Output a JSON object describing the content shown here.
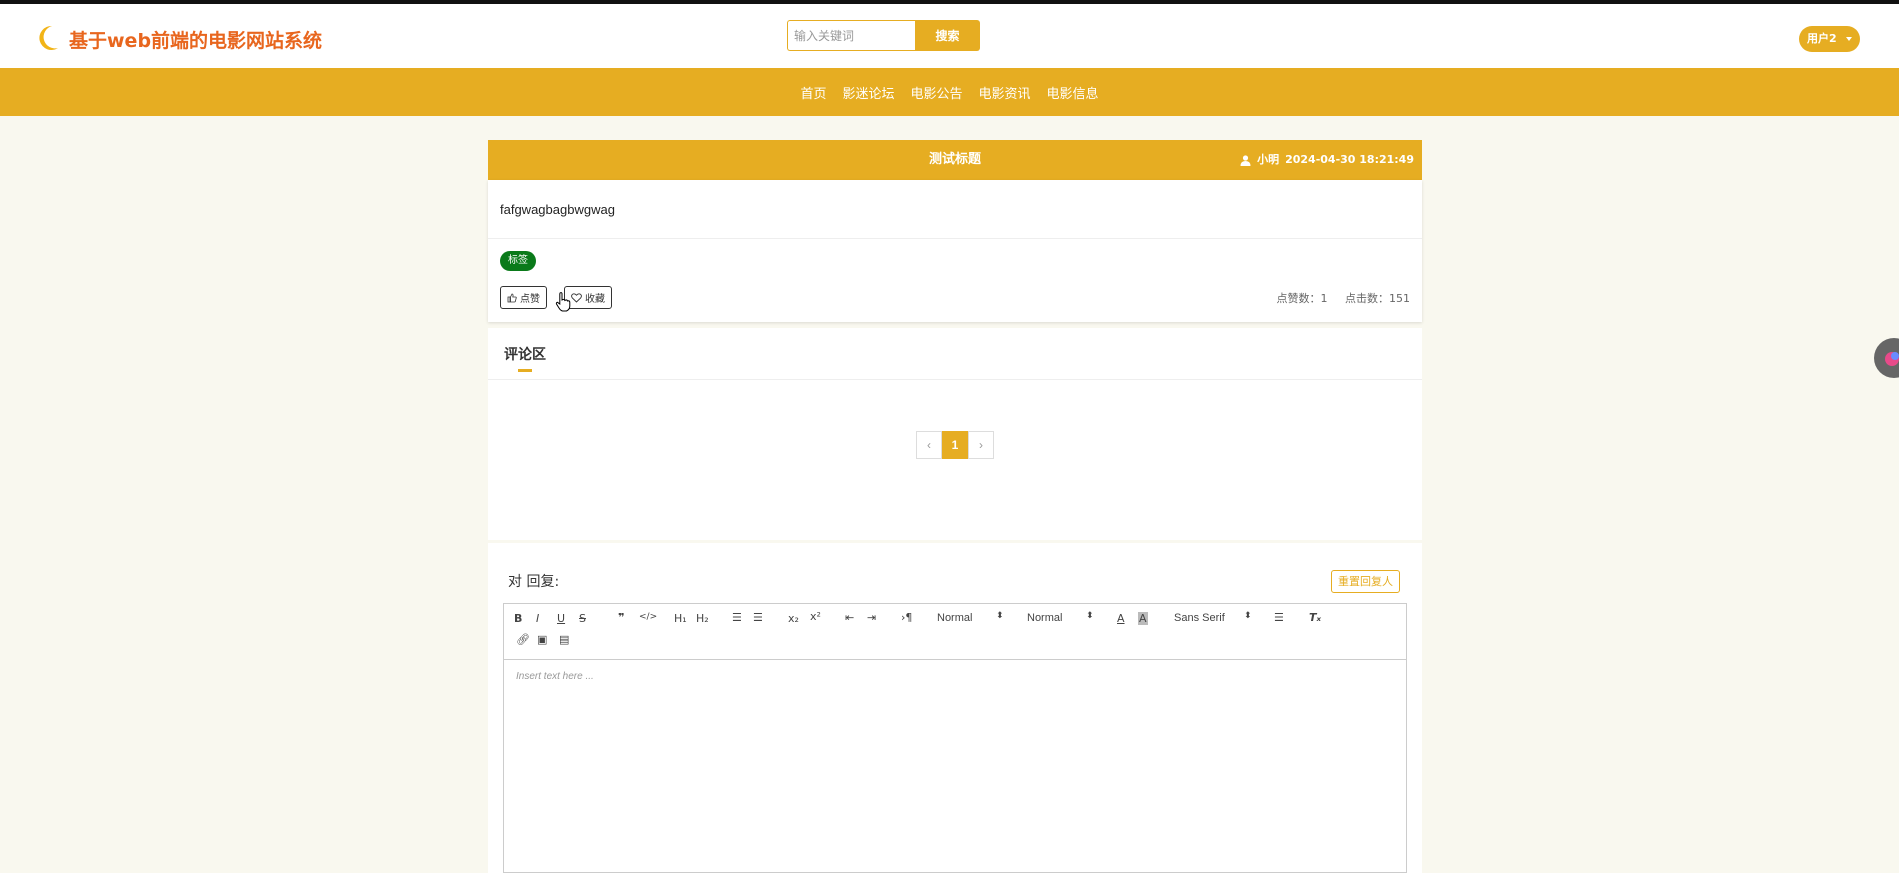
{
  "header": {
    "site_title": "基于web前端的电影网站系统",
    "search_placeholder": "输入关键词",
    "search_button": "搜索",
    "user_label": "用户2"
  },
  "nav": {
    "items": [
      "首页",
      "影迷论坛",
      "电影公告",
      "电影资讯",
      "电影信息"
    ]
  },
  "post": {
    "title": "测试标题",
    "author": "小明",
    "datetime": "2024-04-30 18:21:49",
    "content": "fafgwagbagbwgwag",
    "tag": "标签",
    "like_button": "点赞",
    "favorite_button": "收藏",
    "likes_label": "点赞数：1",
    "clicks_label": "点击数：151"
  },
  "comments": {
    "title": "评论区",
    "pagination": {
      "prev": "‹",
      "current": "1",
      "next": "›"
    }
  },
  "reply": {
    "label": "对 回复:",
    "reset_button": "重置回复人",
    "editor": {
      "header_select": "Normal",
      "size_select": "Normal",
      "font_select": "Sans Serif",
      "placeholder": "Insert text here ..."
    }
  },
  "colors": {
    "accent": "#e6ad22",
    "title_orange": "#e8661e",
    "tag_green": "#0a7a1a",
    "page_bg": "#f9f8ef"
  }
}
